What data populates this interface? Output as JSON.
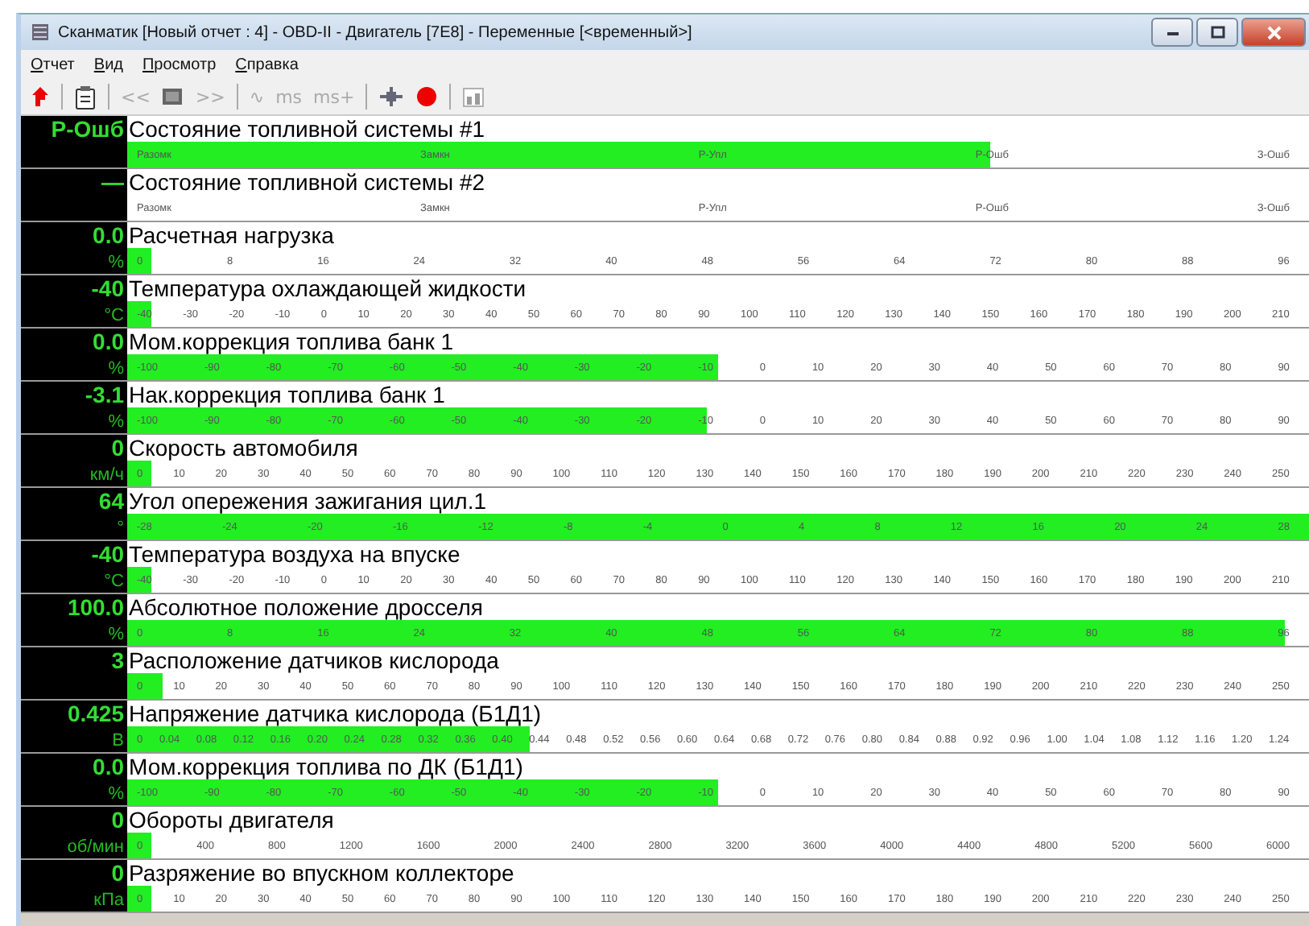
{
  "window": {
    "title": "Сканматик [Новый отчет : 4] - OBD-II - Двигатель [7E8] - Переменные [<временный>]"
  },
  "menu": [
    "Отчет",
    "Вид",
    "Просмотр",
    "Справка"
  ],
  "toolbar": [
    {
      "kind": "arrow",
      "disabled": false
    },
    {
      "kind": "sep"
    },
    {
      "kind": "notepad",
      "disabled": false
    },
    {
      "kind": "sep"
    },
    {
      "kind": "text",
      "label": "<<",
      "disabled": true
    },
    {
      "kind": "square",
      "disabled": false
    },
    {
      "kind": "text",
      "label": ">>",
      "disabled": true
    },
    {
      "kind": "sep"
    },
    {
      "kind": "text",
      "label": "∿",
      "disabled": true
    },
    {
      "kind": "text",
      "label": "ms",
      "disabled": true
    },
    {
      "kind": "text",
      "label": "ms+",
      "disabled": true
    },
    {
      "kind": "sep"
    },
    {
      "kind": "crosshair",
      "disabled": false
    },
    {
      "kind": "record",
      "disabled": false
    },
    {
      "kind": "sep"
    },
    {
      "kind": "chart",
      "disabled": true
    }
  ],
  "rows": [
    {
      "value": "P-Ошб",
      "name": "Состояние топливной системы #1",
      "level": 0.73,
      "ticks": [
        "Разомк",
        "Замкн",
        "P-Упл",
        "Р-Ошб",
        "З-Ошб"
      ]
    },
    {
      "value": "—",
      "name": "Состояние топливной системы #2",
      "ticks": [
        "Разомк",
        "Замкн",
        "P-Упл",
        "Р-Ошб",
        "З-Ошб"
      ]
    },
    {
      "value": "0.0",
      "unit": "%",
      "name": "Расчетная нагрузка",
      "level": 0.02,
      "ticks": [
        "0",
        "8",
        "16",
        "24",
        "32",
        "40",
        "48",
        "56",
        "64",
        "72",
        "80",
        "88",
        "96"
      ]
    },
    {
      "value": "-40",
      "unit": "°C",
      "name": "Температура охлаждающей жидкости",
      "level": 0.02,
      "ticks": [
        "-40",
        "-30",
        "-20",
        "-10",
        "0",
        "10",
        "20",
        "30",
        "40",
        "50",
        "60",
        "70",
        "80",
        "90",
        "100",
        "110",
        "120",
        "130",
        "140",
        "150",
        "160",
        "170",
        "180",
        "190",
        "200",
        "210"
      ]
    },
    {
      "value": "0.0",
      "unit": "%",
      "name": "Мом.коррекция топлива банк 1",
      "level": 0.5,
      "ticks": [
        "-100",
        "-90",
        "-80",
        "-70",
        "-60",
        "-50",
        "-40",
        "-30",
        "-20",
        "-10",
        "0",
        "10",
        "20",
        "30",
        "40",
        "50",
        "60",
        "70",
        "80",
        "90"
      ]
    },
    {
      "value": "-3.1",
      "unit": "%",
      "name": "Нак.коррекция топлива банк 1",
      "level": 0.49,
      "ticks": [
        "-100",
        "-90",
        "-80",
        "-70",
        "-60",
        "-50",
        "-40",
        "-30",
        "-20",
        "-10",
        "0",
        "10",
        "20",
        "30",
        "40",
        "50",
        "60",
        "70",
        "80",
        "90"
      ]
    },
    {
      "value": "0",
      "unit": "км/ч",
      "name": "Скорость автомобиля",
      "level": 0.02,
      "ticks": [
        "0",
        "10",
        "20",
        "30",
        "40",
        "50",
        "60",
        "70",
        "80",
        "90",
        "100",
        "110",
        "120",
        "130",
        "140",
        "150",
        "160",
        "170",
        "180",
        "190",
        "200",
        "210",
        "220",
        "230",
        "240",
        "250"
      ]
    },
    {
      "value": "64",
      "unit": "°",
      "name": "Угол опережения зажигания цил.1",
      "level": 1,
      "ticks": [
        "-28",
        "-24",
        "-20",
        "-16",
        "-12",
        "-8",
        "-4",
        "0",
        "4",
        "8",
        "12",
        "16",
        "20",
        "24",
        "28"
      ]
    },
    {
      "value": "-40",
      "unit": "°C",
      "name": "Температура воздуха на впуске",
      "level": 0.02,
      "ticks": [
        "-40",
        "-30",
        "-20",
        "-10",
        "0",
        "10",
        "20",
        "30",
        "40",
        "50",
        "60",
        "70",
        "80",
        "90",
        "100",
        "110",
        "120",
        "130",
        "140",
        "150",
        "160",
        "170",
        "180",
        "190",
        "200",
        "210"
      ]
    },
    {
      "value": "100.0",
      "unit": "%",
      "name": "Абсолютное положение дросселя",
      "level": 0.98,
      "ticks": [
        "0",
        "8",
        "16",
        "24",
        "32",
        "40",
        "48",
        "56",
        "64",
        "72",
        "80",
        "88",
        "96"
      ]
    },
    {
      "value": "3",
      "name": "Расположение датчиков кислорода",
      "level": 0.03,
      "ticks": [
        "0",
        "10",
        "20",
        "30",
        "40",
        "50",
        "60",
        "70",
        "80",
        "90",
        "100",
        "110",
        "120",
        "130",
        "140",
        "150",
        "160",
        "170",
        "180",
        "190",
        "200",
        "210",
        "220",
        "230",
        "240",
        "250"
      ]
    },
    {
      "value": "0.425",
      "unit": "В",
      "name": "Напряжение датчика кислорода (Б1Д1)",
      "level": 0.34,
      "ticks": [
        "0",
        "0.04",
        "0.08",
        "0.12",
        "0.16",
        "0.20",
        "0.24",
        "0.28",
        "0.32",
        "0.36",
        "0.40",
        "0.44",
        "0.48",
        "0.52",
        "0.56",
        "0.60",
        "0.64",
        "0.68",
        "0.72",
        "0.76",
        "0.80",
        "0.84",
        "0.88",
        "0.92",
        "0.96",
        "1.00",
        "1.04",
        "1.08",
        "1.12",
        "1.16",
        "1.20",
        "1.24"
      ]
    },
    {
      "value": "0.0",
      "unit": "%",
      "name": "Мом.коррекция топлива по ДК (Б1Д1)",
      "level": 0.5,
      "ticks": [
        "-100",
        "-90",
        "-80",
        "-70",
        "-60",
        "-50",
        "-40",
        "-30",
        "-20",
        "-10",
        "0",
        "10",
        "20",
        "30",
        "40",
        "50",
        "60",
        "70",
        "80",
        "90"
      ]
    },
    {
      "value": "0",
      "unit": "об/мин",
      "name": "Обороты двигателя",
      "level": 0.02,
      "ticks": [
        "0",
        "400",
        "800",
        "1200",
        "1600",
        "2000",
        "2400",
        "2800",
        "3200",
        "3600",
        "4000",
        "4400",
        "4800",
        "5200",
        "5600",
        "6000"
      ]
    },
    {
      "value": "0",
      "unit": "кПа",
      "name": "Разряжение во впускном коллекторе",
      "level": 0.02,
      "ticks": [
        "0",
        "10",
        "20",
        "30",
        "40",
        "50",
        "60",
        "70",
        "80",
        "90",
        "100",
        "110",
        "120",
        "130",
        "140",
        "150",
        "160",
        "170",
        "180",
        "190",
        "200",
        "210",
        "220",
        "230",
        "240",
        "250"
      ]
    }
  ]
}
